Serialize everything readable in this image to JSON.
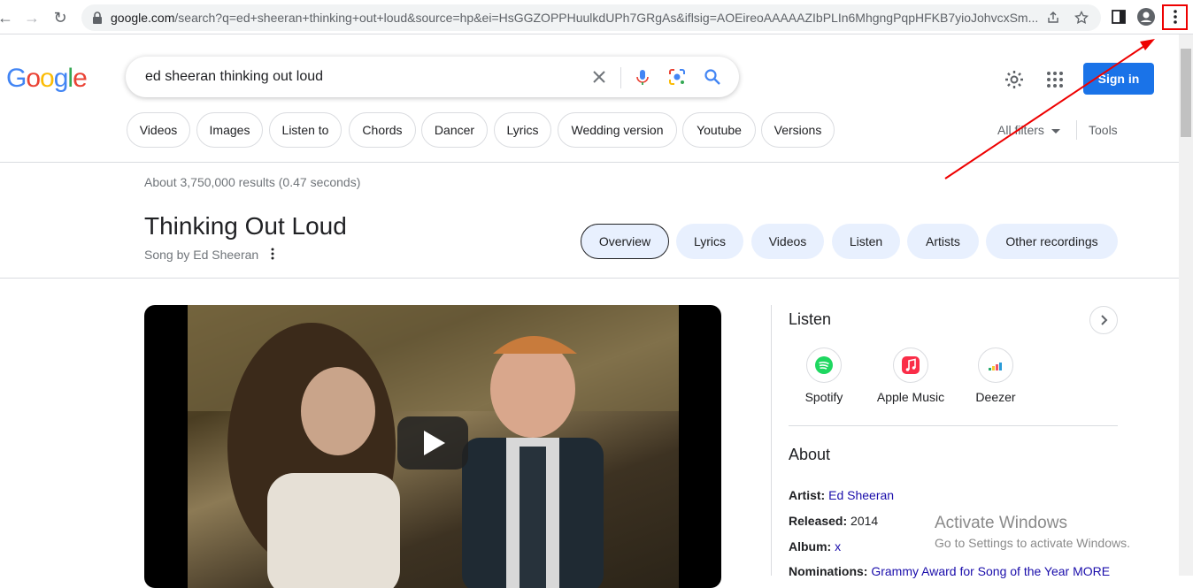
{
  "browser": {
    "url_domain": "google.com",
    "url_rest": "/search?q=ed+sheeran+thinking+out+loud&source=hp&ei=HsGGZOPPHuulkdUPh7GRgAs&iflsig=AOEireoAAAAAZIbPLIn6MhgngPqpHFKB7yioJohvcxSm..."
  },
  "google": {
    "logo_letters": [
      {
        "ch": "G",
        "color": "#4285f4"
      },
      {
        "ch": "o",
        "color": "#ea4335"
      },
      {
        "ch": "o",
        "color": "#fbbc05"
      },
      {
        "ch": "g",
        "color": "#4285f4"
      },
      {
        "ch": "l",
        "color": "#34a853"
      },
      {
        "ch": "e",
        "color": "#ea4335"
      }
    ],
    "query": "ed sheeran thinking out loud",
    "sign_in": "Sign in"
  },
  "filters": {
    "chips": [
      "Videos",
      "Images",
      "Listen to",
      "Chords",
      "Dancer",
      "Lyrics",
      "Wedding version",
      "Youtube",
      "Versions"
    ],
    "all_filters": "All filters",
    "tools": "Tools"
  },
  "results": {
    "stats": "About 3,750,000 results (0.47 seconds)"
  },
  "knowledge": {
    "title": "Thinking Out Loud",
    "subtitle": "Song by Ed Sheeran",
    "tabs": [
      "Overview",
      "Lyrics",
      "Videos",
      "Listen",
      "Artists",
      "Other recordings"
    ],
    "active_tab": "Overview"
  },
  "listen": {
    "heading": "Listen",
    "services": [
      {
        "name": "Spotify",
        "icon": "spotify-icon"
      },
      {
        "name": "Apple Music",
        "icon": "apple-music-icon"
      },
      {
        "name": "Deezer",
        "icon": "deezer-icon"
      }
    ]
  },
  "about": {
    "heading": "About",
    "artist_label": "Artist:",
    "artist_value": "Ed Sheeran",
    "released_label": "Released:",
    "released_value": "2014",
    "album_label": "Album:",
    "album_value": "x",
    "nominations_label": "Nominations:",
    "nominations_value": "Grammy Award for Song of the Year",
    "nominations_more": "MORE"
  },
  "watermark": {
    "title": "Activate Windows",
    "subtitle": "Go to Settings to activate Windows."
  },
  "colors": {
    "accent": "#1a73e8",
    "link": "#1a0dab",
    "annotation": "#ee0000"
  }
}
